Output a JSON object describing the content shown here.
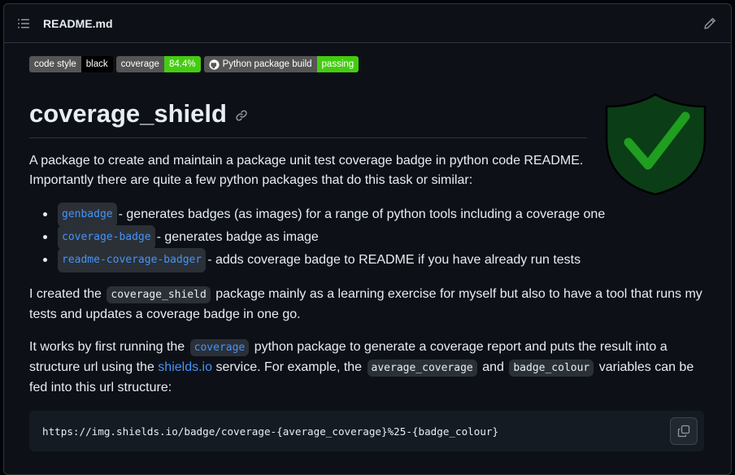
{
  "file": {
    "name": "README.md"
  },
  "badges": [
    {
      "label": "code style",
      "value": "black"
    },
    {
      "label": "coverage",
      "value": "84.4%"
    },
    {
      "label": "Python package build",
      "value": "passing"
    }
  ],
  "readme": {
    "title": "coverage_shield",
    "intro": "A package to create and maintain a package unit test coverage badge in python code README. Importantly there are quite a few python packages that do this task or similar:",
    "list": [
      {
        "code": "genbadge",
        "text": " - generates badges (as images) for a range of python tools including a coverage one"
      },
      {
        "code": "coverage-badge",
        "text": " - generates badge as image"
      },
      {
        "code": "readme-coverage-badger",
        "text": " - adds coverage badge to README if you have already run tests"
      }
    ],
    "p1": {
      "before": "I created the ",
      "code": "coverage_shield",
      "after": " package mainly as a learning exercise for myself but also to have a tool that runs my tests and updates a coverage badge in one go."
    },
    "p2": {
      "t1": "It works by first running the ",
      "code1": "coverage",
      "t2": " python package to generate a coverage report and puts the result into a structure url using the ",
      "link": "shields.io",
      "t3": " service. For example, the ",
      "code2": "average_coverage",
      "t4": " and ",
      "code3": "badge_colour",
      "t5": " variables can be fed into this url structure:"
    },
    "codeblock": "https://img.shields.io/badge/coverage-{average_coverage}%25-{badge_colour}"
  },
  "colors": {
    "accent_link": "#4493f8",
    "badge_green": "#44cc11",
    "shield_fill": "#0b3d17"
  }
}
